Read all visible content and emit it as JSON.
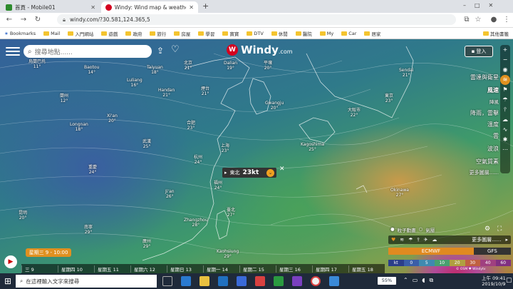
{
  "browser": {
    "tabs": [
      {
        "title": "首頁 - Mobile01",
        "active": false,
        "color": "#2e8b2e",
        "icon_text": "01"
      },
      {
        "title": "Windy: Wind map & weather fo",
        "active": true,
        "color": "#d4001f",
        "icon_text": "W"
      }
    ],
    "new_tab_symbol": "+",
    "url": "windy.com/?30.581,124.365,5",
    "bookmarks": [
      "Bookmarks",
      "Mail",
      "入門網站",
      "遊戲",
      "政府",
      "旅行",
      "房屋",
      "學習",
      "寶寶",
      "DTV",
      "休閒",
      "醫院",
      "My",
      "Car",
      "居家"
    ],
    "other_bookmarks": "其他書籤"
  },
  "map": {
    "search_placeholder": "搜尋地點......",
    "logo_text": "Windy",
    "logo_suffix": ".com",
    "login_label": "登入",
    "layers": [
      "雷達與衛星",
      "風速",
      "陣風",
      "降雨，雷擊",
      "溫度",
      "雲",
      "波浪",
      "空氣質素",
      "更多圖層......"
    ],
    "popup": {
      "direction": "東北",
      "speed": "23kt"
    },
    "cities": [
      {
        "name": "烏蘭巴托",
        "temp": "11°"
      },
      {
        "name": "Baotou",
        "temp": "14°"
      },
      {
        "name": "北京",
        "temp": "21°"
      },
      {
        "name": "Dalian",
        "temp": "19°"
      },
      {
        "name": "平壤",
        "temp": "20°"
      },
      {
        "name": "Sendai",
        "temp": "21°"
      },
      {
        "name": "Luliang",
        "temp": "16°"
      },
      {
        "name": "Handan",
        "temp": "21°"
      },
      {
        "name": "煙台",
        "temp": "21°"
      },
      {
        "name": "Gwangju",
        "temp": "20°"
      },
      {
        "name": "大阪市",
        "temp": "22°"
      },
      {
        "name": "東京",
        "temp": "23°"
      },
      {
        "name": "蘭州",
        "temp": "12°"
      },
      {
        "name": "Xi'an",
        "temp": "20°"
      },
      {
        "name": "合肥",
        "temp": "23°"
      },
      {
        "name": "上海",
        "temp": "23°"
      },
      {
        "name": "Kagoshima",
        "temp": "25°"
      },
      {
        "name": "Longnan",
        "temp": "18°"
      },
      {
        "name": "武漢",
        "temp": "25°"
      },
      {
        "name": "杭州",
        "temp": "24°"
      },
      {
        "name": "重慶",
        "temp": "24°"
      },
      {
        "name": "Ji'an",
        "temp": "26°"
      },
      {
        "name": "福州",
        "temp": "24°"
      },
      {
        "name": "Okinawa",
        "temp": "27°"
      },
      {
        "name": "臺北",
        "temp": "27°"
      },
      {
        "name": "Zhangzhou",
        "temp": "28°"
      },
      {
        "name": "Kaohsiung",
        "temp": "29°"
      },
      {
        "name": "昆明",
        "temp": "20°"
      },
      {
        "name": "廣州",
        "temp": "29°"
      },
      {
        "name": "南寧",
        "temp": "29°"
      },
      {
        "name": "Taiyuan",
        "temp": "18°"
      }
    ],
    "bottom": {
      "current_time": "星期三 9 - 10:00",
      "timeline_days": [
        "三 9",
        "星期四 10",
        "星期五 11",
        "星期六 12",
        "星期日 13",
        "星期一 14",
        "星期二 15",
        "星期三 16",
        "星期四 17",
        "星期五 18"
      ],
      "overlay_labels": [
        "粒子動畫",
        "氣壓"
      ],
      "more_layers": "更多圖層......",
      "models": [
        "ECMWF",
        "GFS"
      ],
      "scale_unit": "kt",
      "scale_values": [
        "0",
        "5",
        "10",
        "20",
        "30",
        "40",
        "60"
      ],
      "attribution": "© OSM ♥ Windytv"
    }
  },
  "taskbar": {
    "search_placeholder": "在這裡輸入文字來搜尋",
    "battery": "55%",
    "time": "上午 09:41",
    "date": "2019/10/9"
  }
}
